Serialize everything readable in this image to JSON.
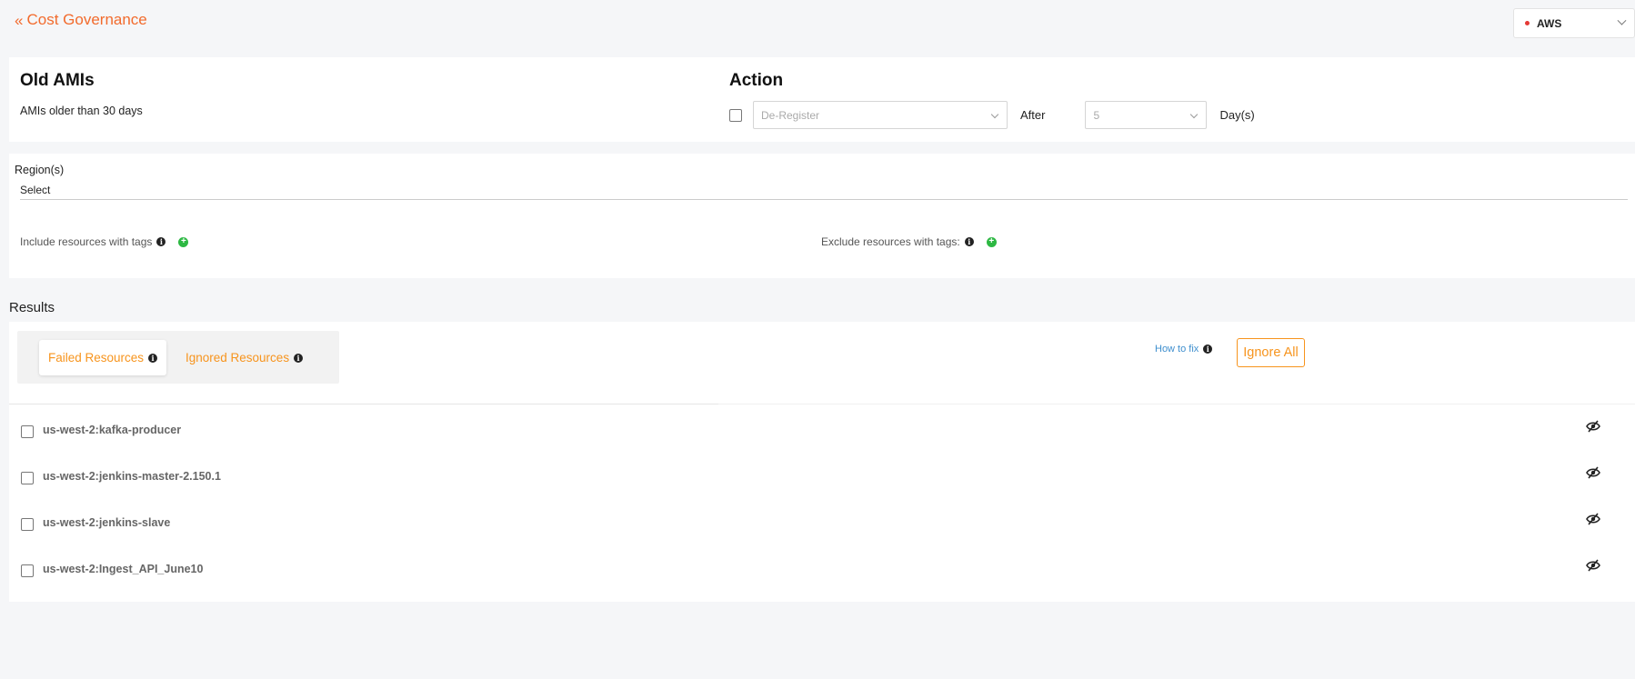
{
  "header": {
    "back_icon": "double-chevron-left-icon",
    "title": "Cost Governance",
    "cloud_select": {
      "value": "AWS",
      "status_color": "#e53935"
    }
  },
  "policy": {
    "title": "Old AMIs",
    "description": "AMIs older than 30 days",
    "action": {
      "title": "Action",
      "action_select": "De-Register",
      "after_label": "After",
      "days_select": "5",
      "days_label": "Day(s)"
    }
  },
  "filters": {
    "region_label": "Region(s)",
    "region_value": "Select",
    "include_tags_label": "Include resources with tags",
    "exclude_tags_label": "Exclude resources with tags:"
  },
  "results": {
    "title": "Results",
    "tabs": [
      {
        "label": "Failed Resources",
        "active": true
      },
      {
        "label": "Ignored Resources",
        "active": false
      }
    ],
    "how_to_fix": "How to fix",
    "ignore_all": "Ignore All",
    "items": [
      {
        "name": "us-west-2:kafka-producer"
      },
      {
        "name": "us-west-2:jenkins-master-2.150.1"
      },
      {
        "name": "us-west-2:jenkins-slave"
      },
      {
        "name": "us-west-2:Ingest_API_June10"
      }
    ]
  },
  "colors": {
    "brand_orange": "#f26b2d",
    "tab_orange": "#f7941d",
    "link_blue": "#3f8fce",
    "add_green": "#2db843"
  }
}
